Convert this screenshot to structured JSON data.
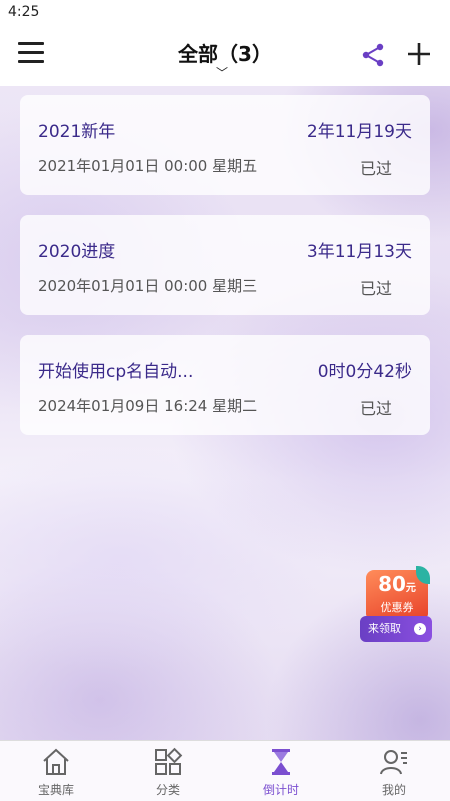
{
  "status_bar": {
    "time": "4:25"
  },
  "header": {
    "title": "全部（3）"
  },
  "events": [
    {
      "name": "2021新年",
      "countdown": "2年11月19天",
      "datetime": "2021年01月01日 00:00 星期五",
      "status": "已过"
    },
    {
      "name": "2020进度",
      "countdown": "3年11月13天",
      "datetime": "2020年01月01日 00:00 星期三",
      "status": "已过"
    },
    {
      "name": "开始使用cp名自动...",
      "countdown": "0时0分42秒",
      "datetime": "2024年01月09日 16:24 星期二",
      "status": "已过"
    }
  ],
  "coupon": {
    "amount": "80",
    "unit": "元",
    "label": "优惠券",
    "cta": "来领取"
  },
  "tabs": [
    {
      "label": "宝典库",
      "icon": "home-icon"
    },
    {
      "label": "分类",
      "icon": "category-icon"
    },
    {
      "label": "倒计时",
      "icon": "hourglass-icon",
      "active": true
    },
    {
      "label": "我的",
      "icon": "profile-icon"
    }
  ],
  "colors": {
    "accent": "#7b4fd0",
    "event_text": "#3b2a8a"
  }
}
